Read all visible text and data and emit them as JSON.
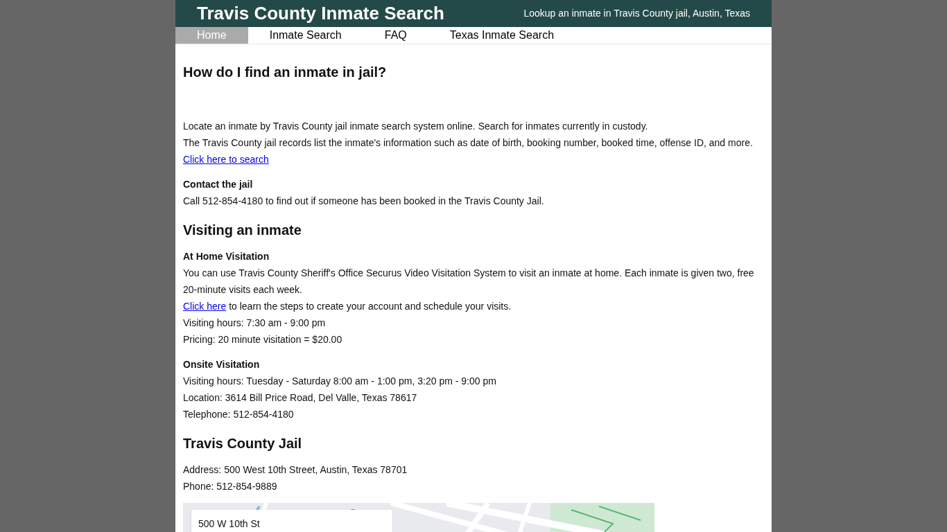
{
  "header": {
    "title": "Travis County Inmate Search",
    "tagline": "Lookup an inmate in Travis County jail, Austin, Texas"
  },
  "nav": [
    {
      "label": "Home",
      "selected": true
    },
    {
      "label": "Inmate Search",
      "selected": false
    },
    {
      "label": "FAQ",
      "selected": false
    },
    {
      "label": "Texas Inmate Search",
      "selected": false
    }
  ],
  "content": [
    {
      "kind": "heading",
      "text": "How do I find an inmate in jail?"
    },
    {
      "kind": "paragraph",
      "text": "Locate an inmate by Travis County jail inmate search system online. Search for inmates currently in custody."
    },
    {
      "kind": "paragraph",
      "text": "The Travis County jail records list the inmate's information such as date of birth, booking number, booked time, offense ID, and more."
    },
    {
      "kind": "link",
      "link": "Click here to search"
    },
    {
      "kind": "subheading",
      "text": "Contact the jail"
    },
    {
      "kind": "paragraph",
      "text": "Call 512-854-4180 to find out if someone has been booked in the Travis County Jail."
    },
    {
      "kind": "heading",
      "text": "Visiting an inmate"
    },
    {
      "kind": "subheading",
      "text": "At Home Visitation"
    },
    {
      "kind": "paragraph",
      "text": "You can use Travis County Sheriff's Office Securus Video Visitation System to visit an inmate at home. Each inmate is given two, free 20-minute visits each week."
    },
    {
      "kind": "link",
      "link": "Click here",
      "text": " to learn the steps to create your account and schedule your visits."
    },
    {
      "kind": "paragraph",
      "text": "Visiting hours: 7:30 am - 9:00 pm"
    },
    {
      "kind": "paragraph",
      "text": "Pricing: 20 minute visitation = $20.00"
    },
    {
      "kind": "subheading",
      "text": "Onsite Visitation"
    },
    {
      "kind": "paragraph",
      "text": "Visiting hours: Tuesday - Saturday 8:00 am - 1:00 pm, 3:20 pm - 9:00 pm"
    },
    {
      "kind": "paragraph",
      "text": "Location: 3614 Bill Price Road, Del Valle, Texas 78617"
    },
    {
      "kind": "paragraph",
      "text": "Telephone: 512-854-4180"
    },
    {
      "kind": "heading",
      "text": "Travis County Jail"
    },
    {
      "kind": "paragraph",
      "text": "Address: 500 West 10th Street, Austin, Texas 78701"
    },
    {
      "kind": "paragraph",
      "text": "Phone: 512-854-9889"
    }
  ],
  "map": {
    "kind": "picture",
    "place_card": "500 W 10th St"
  }
}
